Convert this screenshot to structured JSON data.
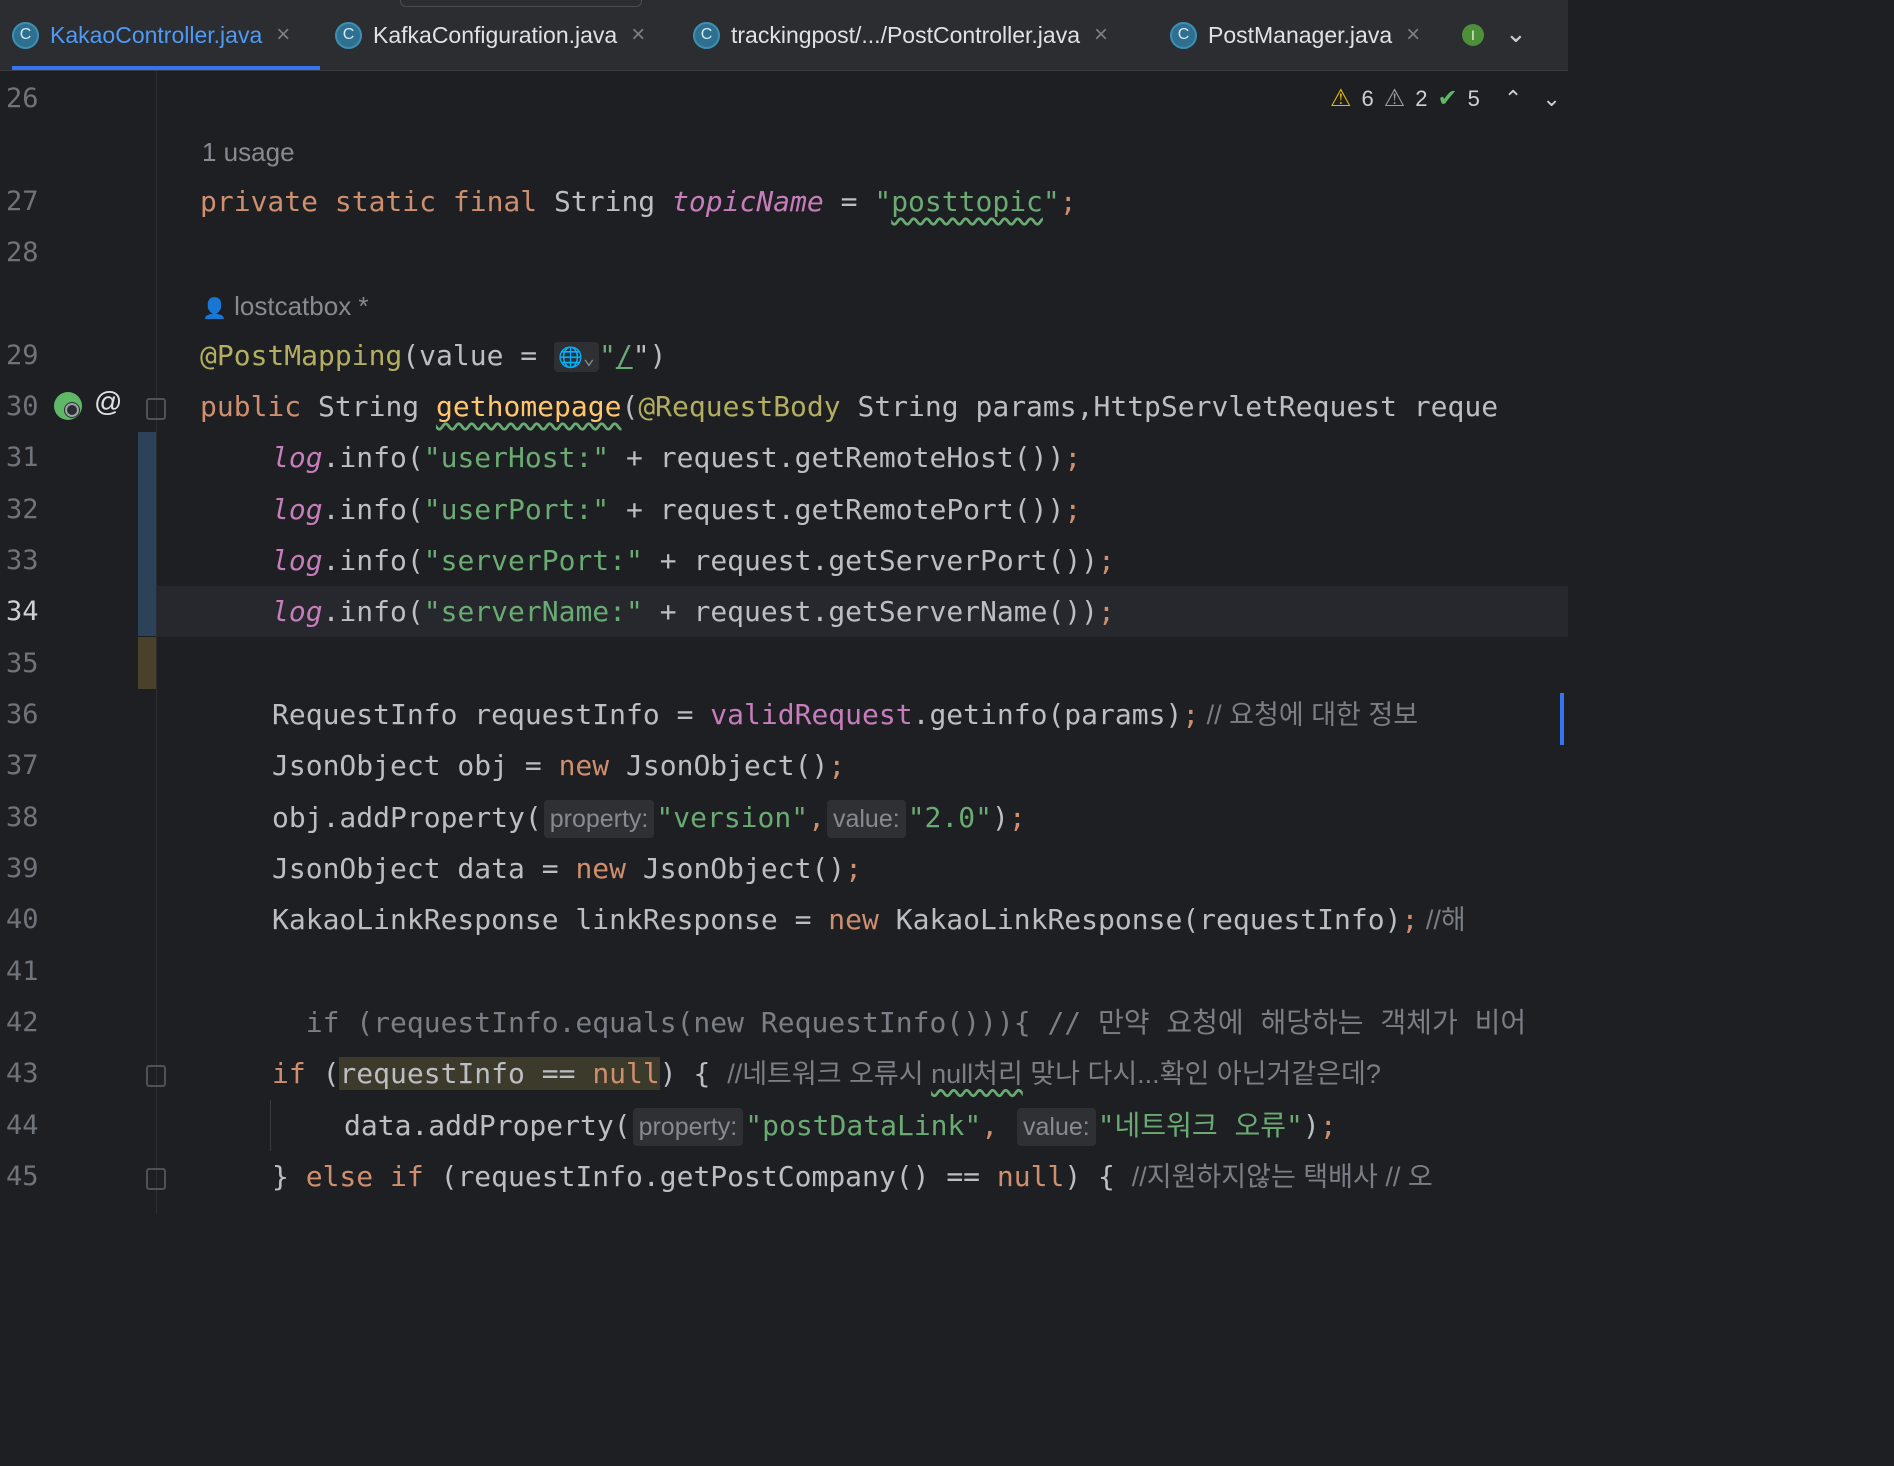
{
  "tabs": [
    {
      "label": "KakaoController.java",
      "icon": "C",
      "active": true
    },
    {
      "label": "KafkaConfiguration.java",
      "icon": "C",
      "active": false
    },
    {
      "label": "trackingpost/.../PostController.java",
      "icon": "C",
      "active": false
    },
    {
      "label": "PostManager.java",
      "icon": "C",
      "active": false
    }
  ],
  "tab_more_icon": "I",
  "tab_close": "×",
  "inspections": {
    "warnings": "6",
    "weak_warnings": "2",
    "typos": "5"
  },
  "hints": {
    "usages": "1 usage",
    "author": "lostcatbox *"
  },
  "line_numbers": [
    "26",
    "27",
    "28",
    "29",
    "30",
    "31",
    "32",
    "33",
    "34",
    "35",
    "36",
    "37",
    "38",
    "39",
    "40",
    "41",
    "42",
    "43",
    "44",
    "45"
  ],
  "current_line": "34",
  "code": {
    "l27": {
      "a": "private static final ",
      "b": "String ",
      "c": "topicName",
      "d": " = ",
      "e": "\"",
      "f": "posttopic",
      "g": "\"",
      "h": ";"
    },
    "l29": {
      "a": "@PostMapping",
      "b": "(value = ",
      "c": "\"",
      "d": "/",
      "e": "\")"
    },
    "l30": {
      "a": "public ",
      "b": "String ",
      "c": "gethomepage",
      "d": "(",
      "e": "@RequestBody",
      "f": " String params,HttpServletRequest reque"
    },
    "l31": {
      "a": "log",
      "b": ".info(",
      "c": "\"userHost:\"",
      "d": " + request.getRemoteHost())",
      "e": ";"
    },
    "l32": {
      "a": "log",
      "b": ".info(",
      "c": "\"userPort:\"",
      "d": " + request.getRemotePort())",
      "e": ";"
    },
    "l33": {
      "a": "log",
      "b": ".info(",
      "c": "\"serverPort:\"",
      "d": " + request.getServerPort())",
      "e": ";"
    },
    "l34": {
      "a": "log",
      "b": ".info(",
      "c": "\"serverName:\"",
      "d": " + request.getServerName())",
      "e": ";"
    },
    "l36": {
      "a": "RequestInfo requestInfo = ",
      "b": "validRequest",
      "c": ".getinfo(params)",
      "d": ";",
      "e": " // 요청에 대한 정보 "
    },
    "l37": {
      "a": "JsonObject obj = ",
      "b": "new",
      "c": " JsonObject()",
      "d": ";"
    },
    "l38": {
      "a": "obj.addProperty(",
      "b": "property:",
      "c": "\"version\"",
      "d": ",",
      "e": "value:",
      "f": "\"2.0\"",
      "g": ")",
      "h": ";"
    },
    "l39": {
      "a": "JsonObject data = ",
      "b": "new",
      "c": " JsonObject()",
      "d": ";"
    },
    "l40": {
      "a": "KakaoLinkResponse linkResponse = ",
      "b": "new",
      "c": " KakaoLinkResponse(requestInfo)",
      "d": ";",
      "e": " //해"
    },
    "l42": {
      "a": "  if (requestInfo.equals(new RequestInfo())){ // 만약 요청에 해당하는 객체가 비어"
    },
    "l43": {
      "a": "if",
      "b": " (",
      "c": "requestInfo == ",
      "d": "null",
      "e": ") { ",
      "f": "//네트워크 오류시 ",
      "g": "null처리",
      "h": " 맞나 다시...확인 아닌거같은데?"
    },
    "l44": {
      "a": "data.addProperty(",
      "b": "property:",
      "c": "\"postDataLink\"",
      "d": ",",
      "e": "value:",
      "f": "\"네트워크 오류\"",
      "g": ")",
      "h": ";"
    },
    "l45": {
      "a": "} ",
      "b": "else if",
      "c": " (requestInfo.getPostCompany() == ",
      "d": "null",
      "e": ") { ",
      "f": "//지원하지않는 택배사 // 오"
    }
  },
  "colors": {
    "keyword": "#cf8e6d",
    "string": "#6aab73",
    "annotation": "#b3ae60",
    "field": "#c77dbb",
    "comment": "#7a7e85",
    "accent": "#3574f0"
  }
}
